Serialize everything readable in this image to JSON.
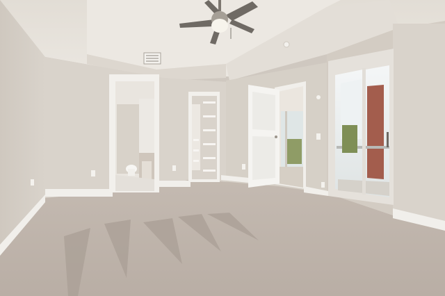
{
  "scene": {
    "room": "empty bedroom",
    "palette": {
      "wall": "#d8d2ca",
      "wall_shadow": "#c9c2b9",
      "ceiling": "#e6e1da",
      "carpet": "#bfb4ab",
      "carpet_dark": "#ada198",
      "trim": "#f3f1ed",
      "door": "#f4f3f0",
      "glass": "#e9eef0",
      "brick": "#a35d4d",
      "foliage": "#7f8f56"
    }
  }
}
